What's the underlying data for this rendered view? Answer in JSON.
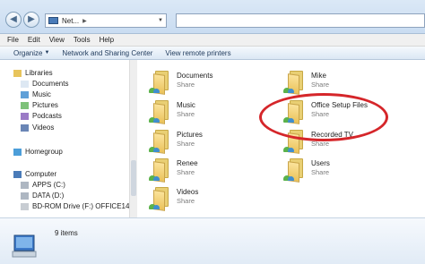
{
  "address": {
    "path": "Net...",
    "separator": "▶"
  },
  "menu": [
    "File",
    "Edit",
    "View",
    "Tools",
    "Help"
  ],
  "commands": {
    "organize": "Organize",
    "network_center": "Network and Sharing Center",
    "view_printers": "View remote printers"
  },
  "nav": [
    {
      "label": "Libraries",
      "icon": "libraries-icon",
      "indent": 0
    },
    {
      "label": "Documents",
      "icon": "documents-icon",
      "indent": 1
    },
    {
      "label": "Music",
      "icon": "music-icon",
      "indent": 1
    },
    {
      "label": "Pictures",
      "icon": "pictures-icon",
      "indent": 1
    },
    {
      "label": "Podcasts",
      "icon": "podcasts-icon",
      "indent": 1
    },
    {
      "label": "Videos",
      "icon": "videos-icon",
      "indent": 1
    },
    {
      "label": "Homegroup",
      "icon": "homegroup-icon",
      "indent": 0
    },
    {
      "label": "Computer",
      "icon": "computer-icon",
      "indent": 0
    },
    {
      "label": "APPS (C:)",
      "icon": "drive-icon",
      "indent": 1
    },
    {
      "label": "DATA (D:)",
      "icon": "drive-icon",
      "indent": 1
    },
    {
      "label": "BD-ROM Drive (F:) OFFICE14",
      "icon": "disc-drive-icon",
      "indent": 1
    }
  ],
  "items": [
    {
      "name": "Documents",
      "sub": "Share"
    },
    {
      "name": "Mike",
      "sub": "Share"
    },
    {
      "name": "Music",
      "sub": "Share"
    },
    {
      "name": "Office Setup Files",
      "sub": "Share"
    },
    {
      "name": "Pictures",
      "sub": "Share"
    },
    {
      "name": "Recorded TV",
      "sub": "Share"
    },
    {
      "name": "Renee",
      "sub": "Share"
    },
    {
      "name": "Users",
      "sub": "Share"
    },
    {
      "name": "Videos",
      "sub": "Share"
    }
  ],
  "status": {
    "count": "9 items"
  },
  "colors": {
    "highlight_circle": "#d5262a"
  }
}
